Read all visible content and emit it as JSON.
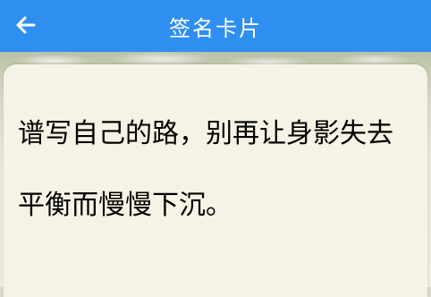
{
  "header": {
    "title": "签名卡片",
    "back_icon": "back-arrow-icon"
  },
  "card": {
    "text": "谱写自己的路，别再让身影失去平衡而慢慢下沉。"
  },
  "colors": {
    "app_bar": "#2f8ff0",
    "card_background": "#f6f3e6",
    "text": "#000000"
  }
}
